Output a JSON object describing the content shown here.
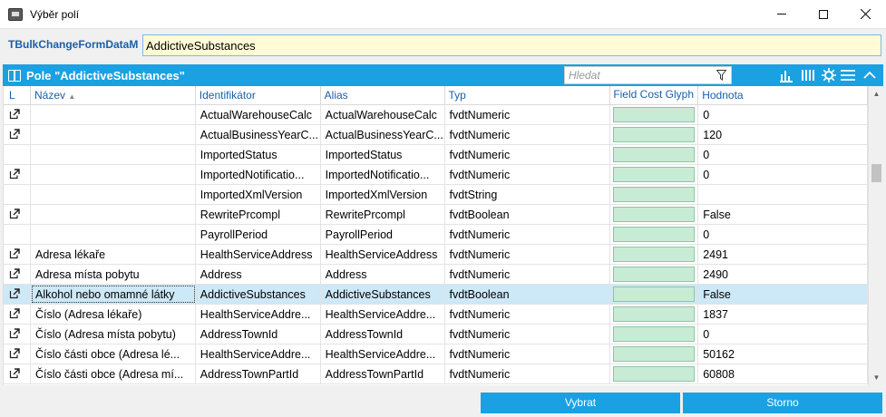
{
  "window": {
    "title": "Výběr polí"
  },
  "form": {
    "label": "TBulkChangeFormDataM",
    "value": "AddictiveSubstances"
  },
  "panel": {
    "title": "Pole \"AddictiveSubstances\"",
    "search_placeholder": "Hledat"
  },
  "columns": {
    "l": "L",
    "name": "Název",
    "id": "Identifikátor",
    "alias": "Alias",
    "type": "Typ",
    "glyph": "Field Cost Glyph",
    "value": "Hodnota"
  },
  "rows": [
    {
      "link": true,
      "name": "",
      "id": "ActualWarehouseCalc",
      "alias": "ActualWarehouseCalc",
      "type": "fvdtNumeric",
      "value": "0"
    },
    {
      "link": true,
      "name": "",
      "id": "ActualBusinessYearC...",
      "alias": "ActualBusinessYearC...",
      "type": "fvdtNumeric",
      "value": "120"
    },
    {
      "link": false,
      "name": "",
      "id": "ImportedStatus",
      "alias": "ImportedStatus",
      "type": "fvdtNumeric",
      "value": "0"
    },
    {
      "link": true,
      "name": "",
      "id": "ImportedNotificatio...",
      "alias": "ImportedNotificatio...",
      "type": "fvdtNumeric",
      "value": "0"
    },
    {
      "link": false,
      "name": "",
      "id": "ImportedXmlVersion",
      "alias": "ImportedXmlVersion",
      "type": "fvdtString",
      "value": ""
    },
    {
      "link": true,
      "name": "",
      "id": "RewritePrcompl",
      "alias": "RewritePrcompl",
      "type": "fvdtBoolean",
      "value": "False"
    },
    {
      "link": false,
      "name": "",
      "id": "PayrollPeriod",
      "alias": "PayrollPeriod",
      "type": "fvdtNumeric",
      "value": "0"
    },
    {
      "link": true,
      "name": "Adresa lékaře",
      "id": "HealthServiceAddress",
      "alias": "HealthServiceAddress",
      "type": "fvdtNumeric",
      "value": "2491"
    },
    {
      "link": true,
      "name": "Adresa místa pobytu",
      "id": "Address",
      "alias": "Address",
      "type": "fvdtNumeric",
      "value": "2490"
    },
    {
      "link": true,
      "name": "Alkohol nebo omamné látky",
      "id": "AddictiveSubstances",
      "alias": "AddictiveSubstances",
      "type": "fvdtBoolean",
      "value": "False",
      "selected": true
    },
    {
      "link": true,
      "name": "Číslo (Adresa lékaře)",
      "id": "HealthServiceAddre...",
      "alias": "HealthServiceAddre...",
      "type": "fvdtNumeric",
      "value": "1837"
    },
    {
      "link": true,
      "name": "Číslo (Adresa místa pobytu)",
      "id": "AddressTownId",
      "alias": "AddressTownId",
      "type": "fvdtNumeric",
      "value": "0"
    },
    {
      "link": true,
      "name": "Číslo části obce (Adresa lé...",
      "id": "HealthServiceAddre...",
      "alias": "HealthServiceAddre...",
      "type": "fvdtNumeric",
      "value": "50162"
    },
    {
      "link": true,
      "name": "Číslo části obce (Adresa mí...",
      "id": "AddressTownPartId",
      "alias": "AddressTownPartId",
      "type": "fvdtNumeric",
      "value": "60808"
    }
  ],
  "buttons": {
    "select": "Vybrat",
    "cancel": "Storno"
  },
  "colors": {
    "accent": "#1ba1e2",
    "selected_row": "#cde8f7",
    "glyph": "#c8ebd6",
    "input_bg": "#fffbd7"
  }
}
